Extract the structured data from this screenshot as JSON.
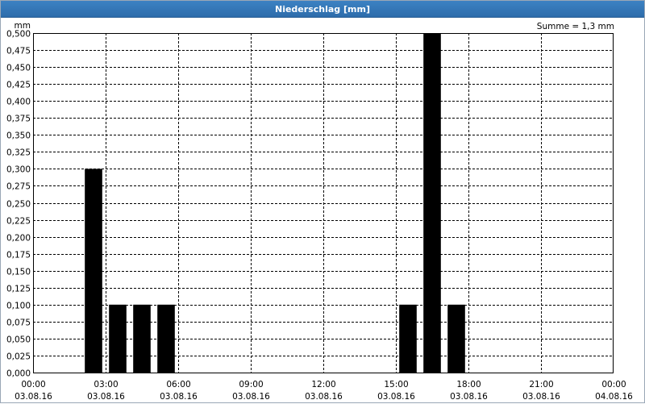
{
  "window": {
    "title": "Niederschlag [mm]"
  },
  "sum_label": "Summe = 1,3 mm",
  "chart_data": {
    "type": "bar",
    "title": "Niederschlag [mm]",
    "ylabel": "mm",
    "ylim": [
      0,
      0.5
    ],
    "y_step": 0.025,
    "y_ticks": [
      "0,000",
      "0,025",
      "0,050",
      "0,075",
      "0,100",
      "0,125",
      "0,150",
      "0,175",
      "0,200",
      "0,225",
      "0,250",
      "0,275",
      "0,300",
      "0,325",
      "0,350",
      "0,375",
      "0,400",
      "0,425",
      "0,450",
      "0,475",
      "0,500"
    ],
    "x_range_hours": [
      0,
      24
    ],
    "x_ticks": [
      {
        "time": "00:00",
        "date": "03.08.16"
      },
      {
        "time": "03:00",
        "date": "03.08.16"
      },
      {
        "time": "06:00",
        "date": "03.08.16"
      },
      {
        "time": "09:00",
        "date": "03.08.16"
      },
      {
        "time": "12:00",
        "date": "03.08.16"
      },
      {
        "time": "15:00",
        "date": "03.08.16"
      },
      {
        "time": "18:00",
        "date": "03.08.16"
      },
      {
        "time": "21:00",
        "date": "03.08.16"
      },
      {
        "time": "00:00",
        "date": "04.08.16"
      }
    ],
    "bars": [
      {
        "hour": "02:00",
        "value": 0.3
      },
      {
        "hour": "03:00",
        "value": 0.1
      },
      {
        "hour": "04:00",
        "value": 0.1
      },
      {
        "hour": "05:00",
        "value": 0.1
      },
      {
        "hour": "15:00",
        "value": 0.1
      },
      {
        "hour": "16:00",
        "value": 0.5
      },
      {
        "hour": "17:00",
        "value": 0.1
      }
    ],
    "grid": true,
    "bar_color": "#000000"
  }
}
